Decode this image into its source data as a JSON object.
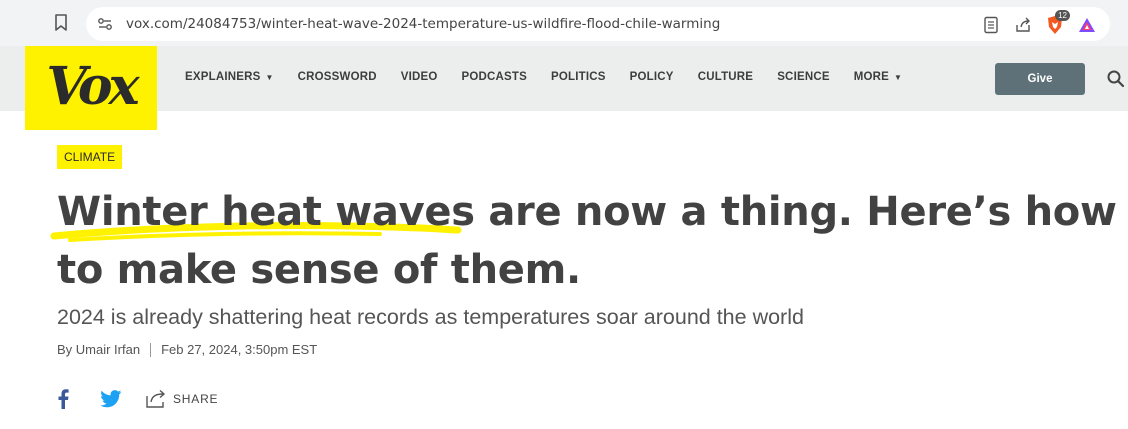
{
  "browser": {
    "url": "vox.com/24084753/winter-heat-wave-2024-temperature-us-wildfire-flood-chile-warming",
    "brave_badge_count": "12"
  },
  "nav": {
    "logo": "Vox",
    "items": [
      {
        "label": "EXPLAINERS",
        "dropdown": true
      },
      {
        "label": "CROSSWORD",
        "dropdown": false
      },
      {
        "label": "VIDEO",
        "dropdown": false
      },
      {
        "label": "PODCASTS",
        "dropdown": false
      },
      {
        "label": "POLITICS",
        "dropdown": false
      },
      {
        "label": "POLICY",
        "dropdown": false
      },
      {
        "label": "CULTURE",
        "dropdown": false
      },
      {
        "label": "SCIENCE",
        "dropdown": false
      },
      {
        "label": "MORE",
        "dropdown": true
      }
    ],
    "give_label": "Give"
  },
  "article": {
    "category": "CLIMATE",
    "headline_part1": "Winter heat waves",
    "headline_part2": " are now a thing. Here’s how to make sense of them.",
    "dek": "2024 is already shattering heat records as temperatures soar around the world",
    "author": "By Umair Irfan",
    "date": "Feb 27, 2024, 3:50pm EST",
    "share_label": "SHARE"
  },
  "colors": {
    "brand_yellow": "#fff200",
    "give_button": "#5e7179",
    "facebook": "#3b5998",
    "twitter": "#1da1f2"
  }
}
